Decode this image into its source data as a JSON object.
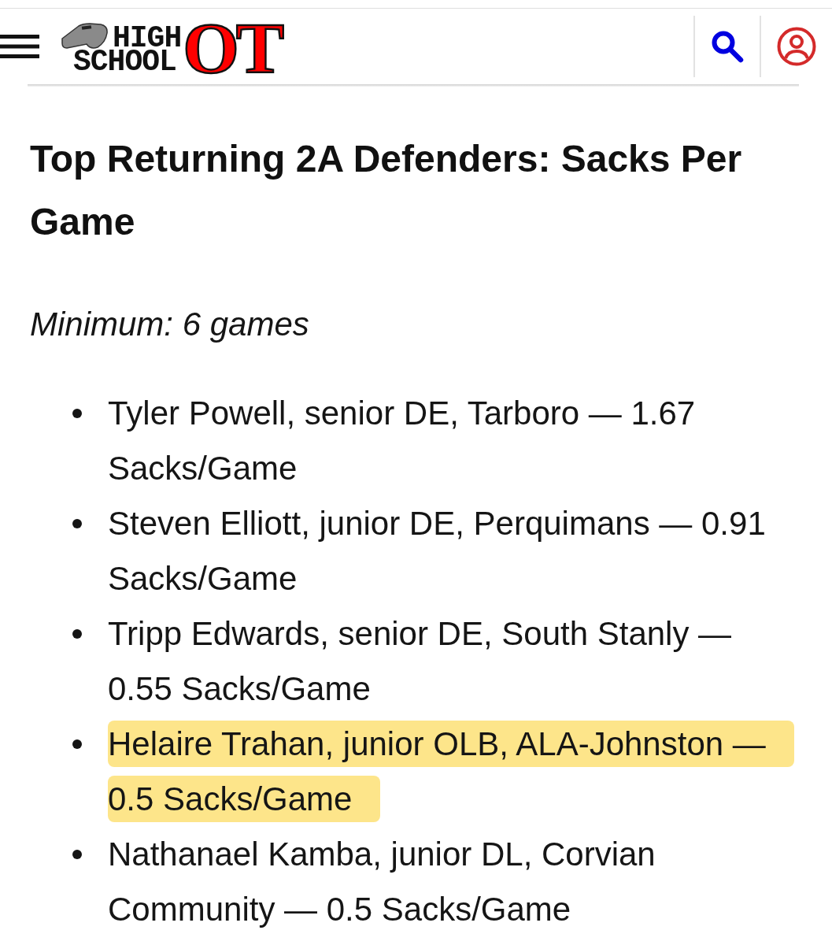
{
  "header": {
    "logo": {
      "line_1": "HIGH",
      "line_2": "SCHOOL",
      "mark": "OT"
    }
  },
  "article": {
    "title": "Top Returning 2A Defenders: Sacks Per Game",
    "note": "Minimum: 6 games",
    "items": [
      {
        "text": "Tyler Powell, senior DE, Tarboro — 1.67 Sacks/Game",
        "highlighted": false
      },
      {
        "text": "Steven Elliott, junior DE, Perquimans — 0.91 Sacks/Game",
        "highlighted": false
      },
      {
        "text": "Tripp Edwards, senior DE, South Stanly — 0.55 Sacks/Game",
        "highlighted": false
      },
      {
        "text": "Helaire Trahan, junior OLB, ALA-Johnston — 0.5 Sacks/Game",
        "highlighted": true
      },
      {
        "text": "Nathanael Kamba, junior DL, Corvian Community — 0.5 Sacks/Game",
        "highlighted": false
      }
    ]
  }
}
